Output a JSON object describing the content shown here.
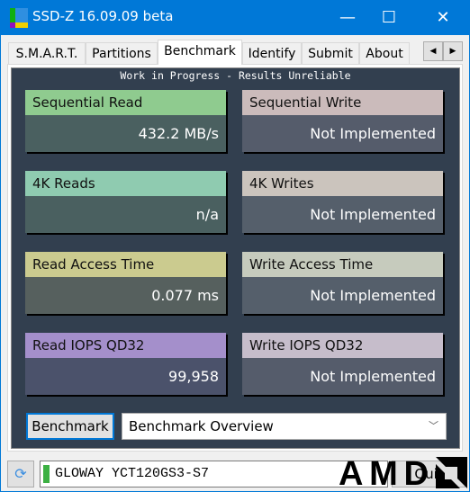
{
  "window": {
    "title": "SSD-Z 16.09.09 beta",
    "minimize": "—",
    "maximize": "☐",
    "close": "✕"
  },
  "tabs": [
    {
      "label": "S.M.A.R.T."
    },
    {
      "label": "Partitions"
    },
    {
      "label": "Benchmark",
      "active": true
    },
    {
      "label": "Identify"
    },
    {
      "label": "Submit"
    },
    {
      "label": "About"
    }
  ],
  "tab_scroll": {
    "left": "◀",
    "right": "▶"
  },
  "benchmark": {
    "notice": "Work in Progress - Results Unreliable",
    "cards": [
      {
        "label": "Sequential Read",
        "value": "432.2 MB/s",
        "header_color": "#8fcb8f",
        "body_color": "#4a6060"
      },
      {
        "label": "Sequential Write",
        "value": "Not Implemented",
        "header_color": "#cbbbbb",
        "body_color": "#555c6b"
      },
      {
        "label": "4K Reads",
        "value": "n/a",
        "header_color": "#8fcbb0",
        "body_color": "#4a6060"
      },
      {
        "label": "4K Writes",
        "value": "Not Implemented",
        "header_color": "#cbc4bd",
        "body_color": "#555f6b"
      },
      {
        "label": "Read Access Time",
        "value": "0.077 ms",
        "header_color": "#cbcb8f",
        "body_color": "#56605e"
      },
      {
        "label": "Write Access Time",
        "value": "Not Implemented",
        "header_color": "#c6cbbd",
        "body_color": "#555f6b"
      },
      {
        "label": "Read IOPS QD32",
        "value": "99,958",
        "header_color": "#a48fcb",
        "body_color": "#4b526b"
      },
      {
        "label": "Write IOPS QD32",
        "value": "Not Implemented",
        "header_color": "#c6bdcb",
        "body_color": "#555c6b"
      }
    ],
    "button": "Benchmark",
    "mode": "Benchmark Overview"
  },
  "status": {
    "drive": "GLOWAY YCT120GS3-S7",
    "quit": "Quit",
    "logo": "AMD",
    "drive_status_color": "#3cb043"
  }
}
